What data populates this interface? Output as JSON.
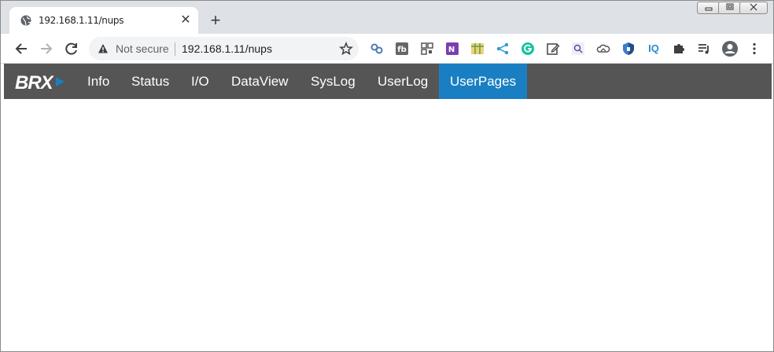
{
  "browser": {
    "tab_title": "192.168.1.11/nups",
    "tab_close_glyph": "✕",
    "new_tab_glyph": "+",
    "security_label": "Not secure",
    "url": "192.168.1.11/nups",
    "window_buttons": {
      "minimize": "▭",
      "maximize": "▣",
      "close": "✕"
    },
    "extensions": [
      "link-extension-icon",
      "fb-extension-icon",
      "qr-extension-icon",
      "onenote-icon",
      "map-extension-icon",
      "share-icon",
      "grammarly-icon",
      "edit-icon",
      "search-extension-icon",
      "cloud-extension-icon",
      "shield-extension-icon",
      "iq-extension-icon",
      "puzzle-icon",
      "media-queue-icon",
      "profile-icon",
      "menu-dots-icon"
    ]
  },
  "app": {
    "logo_text": "BRX",
    "nav": [
      {
        "label": "Info"
      },
      {
        "label": "Status"
      },
      {
        "label": "I/O"
      },
      {
        "label": "DataView"
      },
      {
        "label": "SysLog"
      },
      {
        "label": "UserLog"
      },
      {
        "label": "UserPages",
        "active": true
      }
    ],
    "colors": {
      "navbar": "#555555",
      "active": "#1a7fc2",
      "logo_accent": "#1a7fc2"
    }
  }
}
